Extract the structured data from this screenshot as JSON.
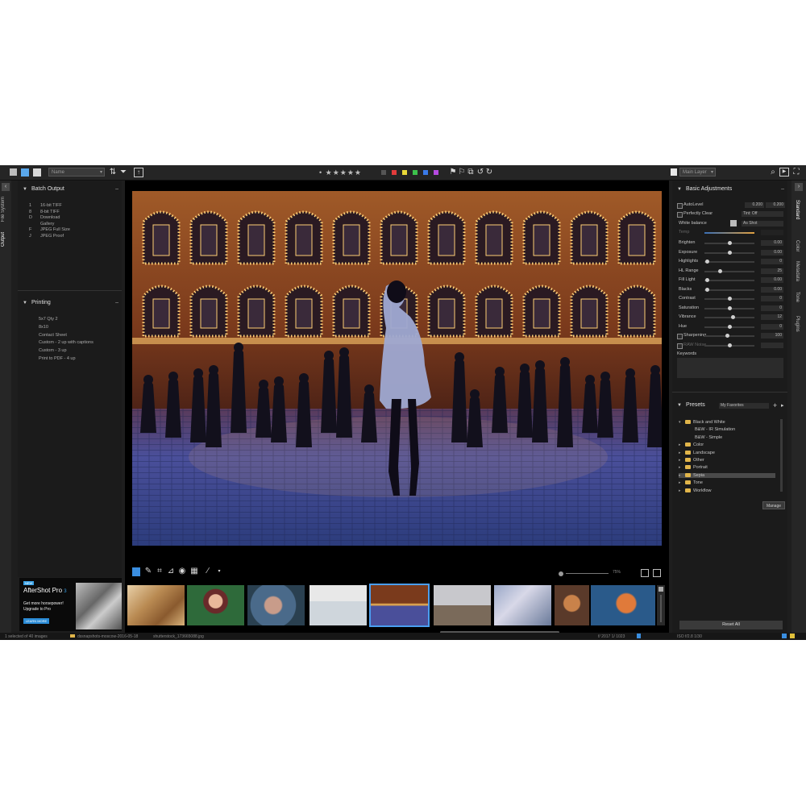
{
  "toolbar": {
    "sort_combo": "Name",
    "stars": "★★★★★",
    "color_labels": [
      "#e23b3b",
      "#e8d838",
      "#3cc24c",
      "#3a7ae8",
      "#b54ae0"
    ],
    "layer_combo": "Main Layer"
  },
  "left_strip": {
    "tabs": [
      "Output",
      "File System"
    ]
  },
  "batch_output": {
    "title": "Batch Output",
    "items": [
      {
        "key": "1",
        "label": "16-bit TIFF"
      },
      {
        "key": "8",
        "label": "8-bit TIFF"
      },
      {
        "key": "D",
        "label": "Download"
      },
      {
        "key": "",
        "label": "Gallery"
      },
      {
        "key": "F",
        "label": "JPEG Full Size"
      },
      {
        "key": "J",
        "label": "JPEG Proof"
      }
    ]
  },
  "printing": {
    "title": "Printing",
    "items": [
      "5x7 Qty 2",
      "8x10",
      "Contact Sheet",
      "Custom - 2 up with captions",
      "Custom - 3 up",
      "Print to PDF - 4 up"
    ]
  },
  "promo": {
    "badge": "NEW",
    "product": "AfterShot Pro",
    "version": "3",
    "line1": "Get more horsepower!",
    "line2": "Upgrade to Pro",
    "button": "LEARN MORE"
  },
  "viewer_toolbar": {
    "zoom": "75%"
  },
  "thumbnails": [
    {
      "name": "thumb-autumn"
    },
    {
      "name": "thumb-portrait-leaves"
    },
    {
      "name": "thumb-baby"
    },
    {
      "name": "thumb-red-umbrella"
    },
    {
      "name": "thumb-night-square",
      "selected": true
    },
    {
      "name": "thumb-horses"
    },
    {
      "name": "thumb-couple"
    },
    {
      "name": "thumb-orangutan"
    },
    {
      "name": "thumb-child-blue"
    }
  ],
  "right_strip": {
    "tabs": [
      "Standard",
      "Color",
      "Metadata",
      "Tone",
      "Plugins"
    ]
  },
  "basic_adjustments": {
    "title": "Basic Adjustments",
    "autolevel": {
      "label": "AutoLevel",
      "v1": "0.200",
      "v2": "0.200"
    },
    "perfectly_clear": {
      "label": "Perfectly Clear",
      "value": "Tint: Off"
    },
    "white_balance": {
      "label": "White balance",
      "value": "As Shot"
    },
    "temp_label": "Temp",
    "sliders": [
      {
        "label": "Brighten",
        "value": "0.00",
        "pos": 0.5
      },
      {
        "label": "Exposure",
        "value": "0.00",
        "pos": 0.5
      },
      {
        "label": "Highlights",
        "value": "0",
        "pos": 0.05
      },
      {
        "label": "HL Range",
        "value": "25",
        "pos": 0.3
      },
      {
        "label": "Fill Light",
        "value": "0.00",
        "pos": 0.05
      },
      {
        "label": "Blacks",
        "value": "0.00",
        "pos": 0.05
      },
      {
        "label": "Contrast",
        "value": "0",
        "pos": 0.5
      },
      {
        "label": "Saturation",
        "value": "0",
        "pos": 0.5
      },
      {
        "label": "Vibrance",
        "value": "12",
        "pos": 0.56
      },
      {
        "label": "Hue",
        "value": "0",
        "pos": 0.5
      },
      {
        "label": "Sharpening",
        "value": "100",
        "pos": 0.45
      },
      {
        "label": "RAW Noise",
        "value": "",
        "pos": 0.5
      }
    ],
    "keywords_label": "Keywords"
  },
  "presets": {
    "title": "Presets",
    "combo": "My Favorites",
    "tree": [
      {
        "label": "Black and White",
        "level": 0,
        "folder": true,
        "open": true
      },
      {
        "label": "B&W - IR Simulation",
        "level": 1,
        "folder": false
      },
      {
        "label": "B&W - Simple",
        "level": 1,
        "folder": false
      },
      {
        "label": "Color",
        "level": 0,
        "folder": true
      },
      {
        "label": "Landscape",
        "level": 0,
        "folder": true
      },
      {
        "label": "Other",
        "level": 0,
        "folder": true
      },
      {
        "label": "Portrait",
        "level": 0,
        "folder": true
      },
      {
        "label": "Sepia",
        "level": 0,
        "folder": true,
        "selected": true
      },
      {
        "label": "Tone",
        "level": 0,
        "folder": true
      },
      {
        "label": "Workflow",
        "level": 0,
        "folder": true
      }
    ],
    "manage_button": "Manage"
  },
  "reset_all": "Reset All",
  "statusbar": {
    "selection": "1 selected of 40 images",
    "path": "dssnapshots-moscow-2016-05-18",
    "file": "shutterstock_173665088.jpg",
    "info": "f/ 2017  1/ 1023",
    "exposure": "ISO  f/2.8  1/30"
  }
}
